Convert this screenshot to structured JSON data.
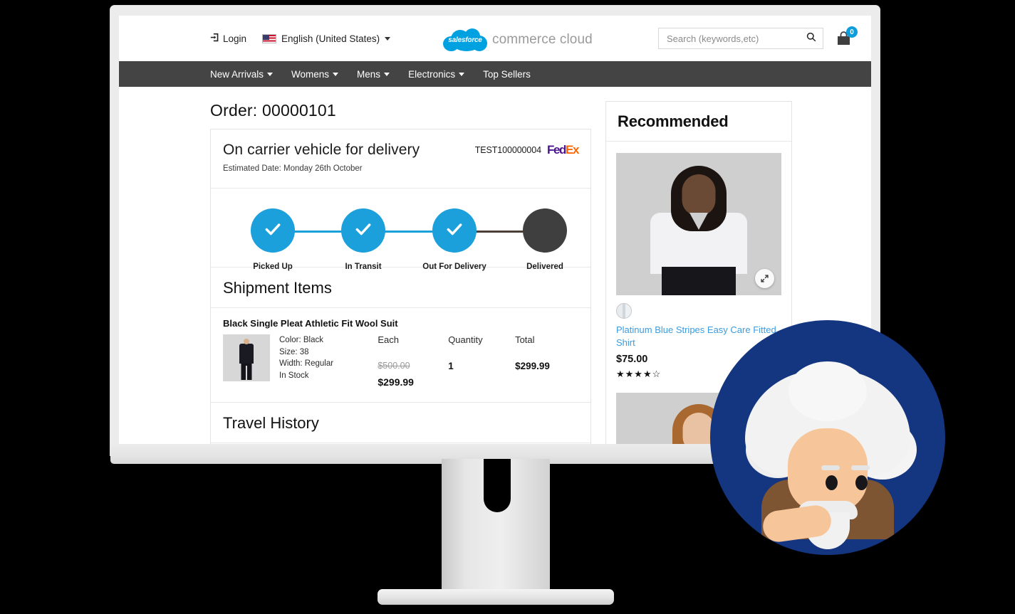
{
  "header": {
    "login_label": "Login",
    "login_icon": "sign-in-icon",
    "locale_label": "English (United States)",
    "flag_icon": "us-flag-icon",
    "brand_logo_word": "salesforce",
    "brand_text": "commerce cloud",
    "search_placeholder": "Search (keywords,etc)",
    "search_value": "",
    "search_icon": "search-icon",
    "cart_icon": "shopping-bag-icon",
    "cart_count": "0"
  },
  "nav": {
    "items": [
      {
        "label": "New Arrivals",
        "has_caret": true
      },
      {
        "label": "Womens",
        "has_caret": true
      },
      {
        "label": "Mens",
        "has_caret": true
      },
      {
        "label": "Electronics",
        "has_caret": true
      },
      {
        "label": "Top Sellers",
        "has_caret": false
      }
    ]
  },
  "order": {
    "title": "Order: 00000101",
    "status_title": "On carrier vehicle for delivery",
    "estimated_date": "Estimated Date: Monday 26th October",
    "tracking_number": "TEST100000004",
    "carrier_fed": "Fed",
    "carrier_ex": "Ex"
  },
  "tracker": {
    "steps": [
      {
        "label": "Picked Up",
        "state": "done"
      },
      {
        "label": "In Transit",
        "state": "done"
      },
      {
        "label": "Out For Delivery",
        "state": "done"
      },
      {
        "label": "Delivered",
        "state": "todo"
      }
    ],
    "done_color": "#1BA0DB",
    "todo_color": "#3f3f3f",
    "check_icon": "check-icon"
  },
  "shipment": {
    "section_title": "Shipment Items",
    "item": {
      "name": "Black Single Pleat Athletic Fit Wool Suit",
      "thumb_icon": "suit-thumbnail",
      "attributes": [
        "Color: Black",
        "Size: 38",
        "Width: Regular",
        "In Stock"
      ],
      "each_header": "Each",
      "quantity_header": "Quantity",
      "total_header": "Total",
      "price_was": "$500.00",
      "price_now": "$299.99",
      "quantity": "1",
      "total": "$299.99"
    }
  },
  "travel_history": {
    "section_title": "Travel History"
  },
  "recommended": {
    "title": "Recommended",
    "products": [
      {
        "image_alt": "woman-in-white-striped-shirt",
        "expand_icon": "expand-icon",
        "swatch_name": "platinum-blue-stripe-swatch",
        "name": "Platinum Blue Stripes Easy Care Fitted Shirt",
        "price": "$75.00",
        "stars_filled": 4,
        "stars_total": 5,
        "star_filled_glyph": "★",
        "star_empty_glyph": "☆"
      },
      {
        "image_alt": "woman-in-white-shirt"
      }
    ]
  },
  "mascot": {
    "name": "einstein-avatar",
    "ring_color": "#14357f"
  }
}
